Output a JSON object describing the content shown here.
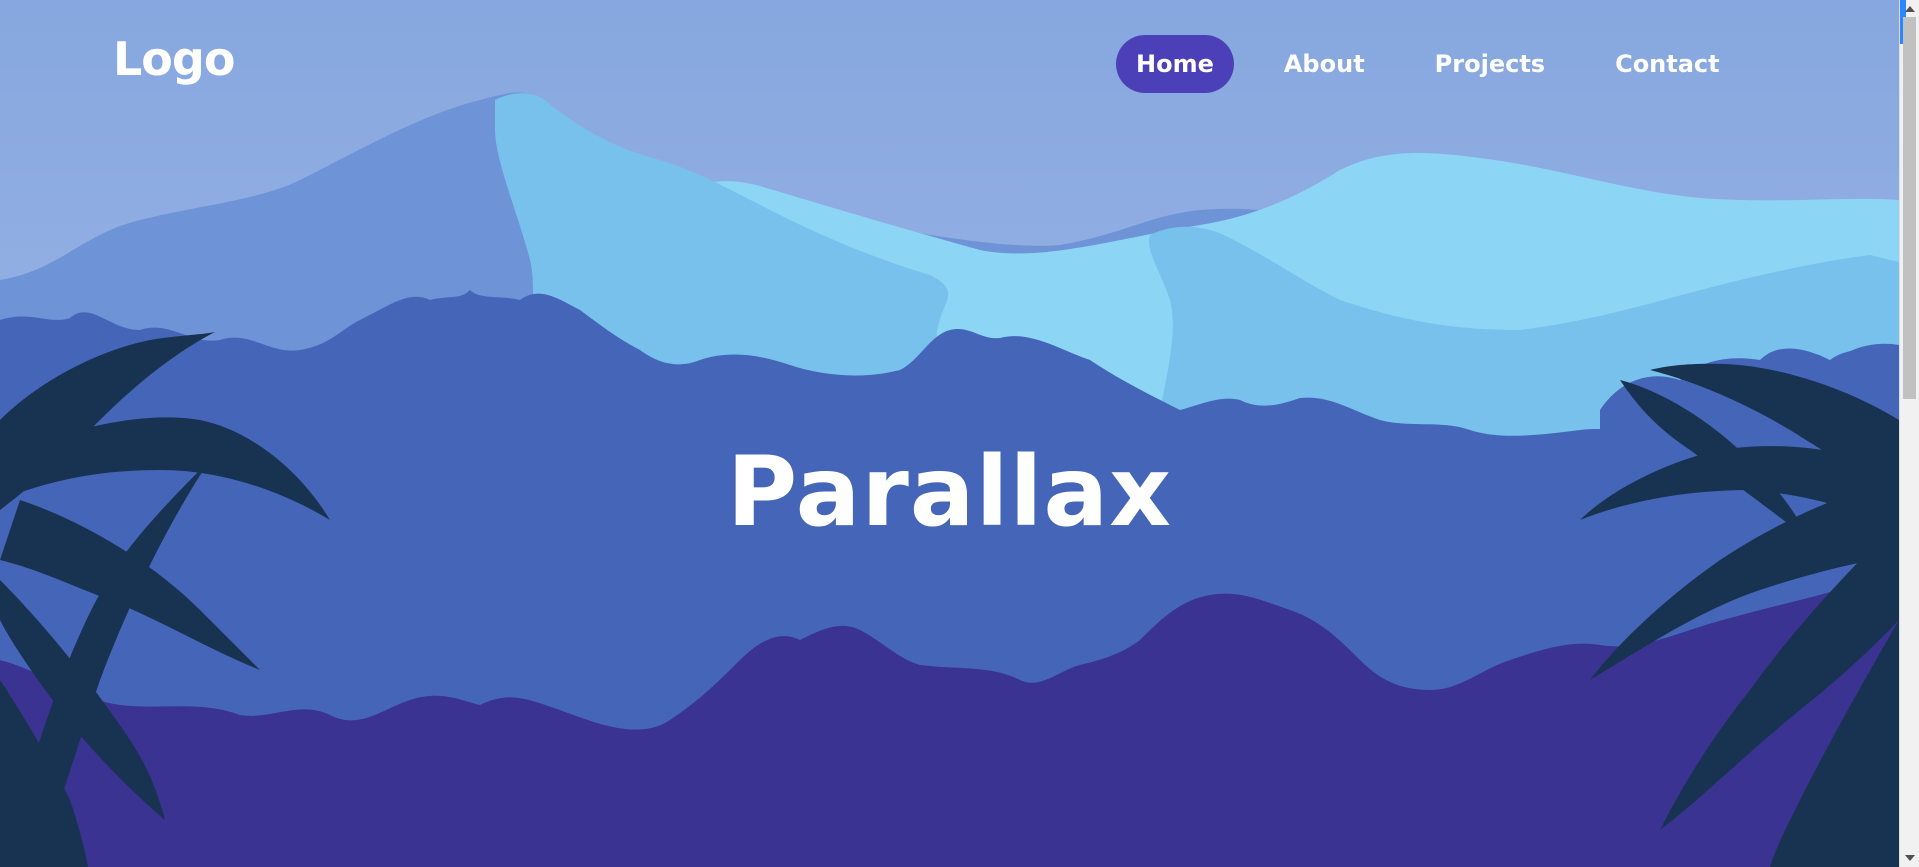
{
  "header": {
    "logo": "Logo",
    "nav": [
      {
        "label": "Home",
        "active": true
      },
      {
        "label": "About",
        "active": false
      },
      {
        "label": "Projects",
        "active": false
      },
      {
        "label": "Contact",
        "active": false
      }
    ]
  },
  "hero": {
    "title": "Parallax"
  },
  "colors": {
    "sky_top": "#86a7df",
    "sky_bottom": "#a2b9e6",
    "mountain_far": "#6e93d6",
    "mountain_light": "#78c1ec",
    "mountain_lightest": "#8dd5f5",
    "forest_mid": "#4566b8",
    "forest_front": "#3b3391",
    "leaves": "#183351",
    "nav_active": "#4c40b8"
  }
}
